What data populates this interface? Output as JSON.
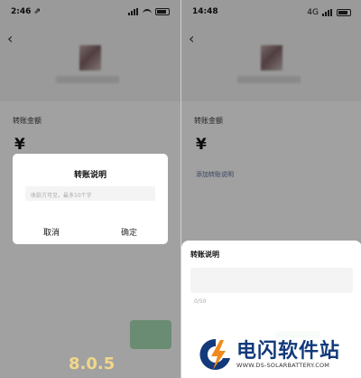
{
  "left": {
    "status_time": "2:46 ⇗",
    "back_symbol": "‹",
    "amount_label": "转账金额",
    "currency": "¥",
    "dialog": {
      "title": "转账说明",
      "placeholder": "收款方可见，最多10个字",
      "cancel": "取消",
      "confirm": "确定"
    },
    "version": "8.0.5"
  },
  "right": {
    "status_time": "14:48",
    "status_net": "4G",
    "back_symbol": "‹",
    "amount_label": "转账金额",
    "currency": "¥",
    "note_link": "添加转账说明",
    "sheet": {
      "title": "转账说明",
      "counter": "0/50"
    }
  },
  "watermark": {
    "title": "电闪软件站",
    "url": "WWW.DS-SOLARBATTERY.COM"
  },
  "colors": {
    "wechat_green": "#2fb05c",
    "link_blue": "#576b95",
    "version_yellow": "#f1d78a",
    "watermark_blue": "#123a7a",
    "watermark_orange": "#f08a1c"
  }
}
